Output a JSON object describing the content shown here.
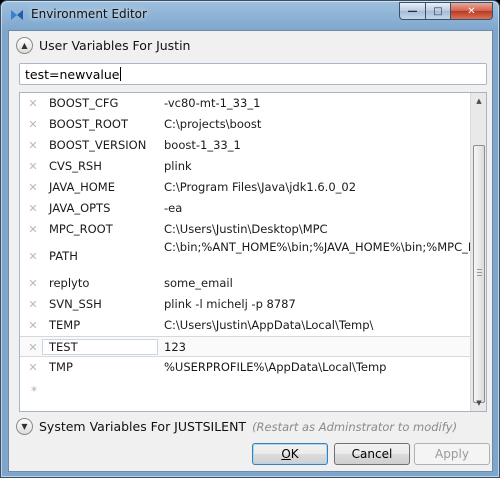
{
  "window": {
    "title": "Environment Editor",
    "controls": {
      "minimize": "—",
      "maximize": "□",
      "close": "✕"
    }
  },
  "user_section": {
    "title": "User Variables For Justin",
    "expander_icon": "chevron-up-icon",
    "edit_value": "test=newvalue"
  },
  "variables": [
    {
      "name": "BOOST_CFG",
      "value": "-vc80-mt-1_33_1"
    },
    {
      "name": "BOOST_ROOT",
      "value": "C:\\projects\\boost"
    },
    {
      "name": "BOOST_VERSION",
      "value": "boost-1_33_1"
    },
    {
      "name": "CVS_RSH",
      "value": "plink"
    },
    {
      "name": "JAVA_HOME",
      "value": "C:\\Program Files\\Java\\jdk1.6.0_02"
    },
    {
      "name": "JAVA_OPTS",
      "value": "-ea"
    },
    {
      "name": "MPC_ROOT",
      "value": "C:\\Users\\Justin\\Desktop\\MPC"
    },
    {
      "name": "PATH",
      "value": "C:\\bin;%ANT_HOME%\\bin;%JAVA_HOME%\\bin;%MPC_ROOT%"
    },
    {
      "name": "replyto",
      "value": "some_email"
    },
    {
      "name": "SVN_SSH",
      "value": "plink -l michelj -p 8787"
    },
    {
      "name": "TEMP",
      "value": "C:\\Users\\Justin\\AppData\\Local\\Temp\\"
    },
    {
      "name": "TEST",
      "value": "123"
    },
    {
      "name": "TMP",
      "value": "%USERPROFILE%\\AppData\\Local\\Temp"
    }
  ],
  "grid": {
    "delete_glyph": "✕",
    "new_row_glyph": "*",
    "selected_index": 11
  },
  "system_section": {
    "title": "System Variables For JUSTSILENT",
    "hint": "(Restart as Adminstrator to modify)",
    "expander_icon": "chevron-down-icon"
  },
  "buttons": {
    "ok_mnemonic": "O",
    "ok_rest": "K",
    "cancel": "Cancel",
    "apply": "Apply"
  }
}
